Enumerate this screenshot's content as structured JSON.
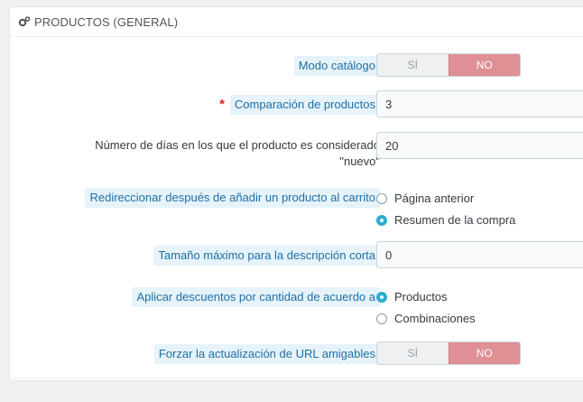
{
  "panel": {
    "title": "PRODUCTOS (GENERAL)",
    "icon": "gears-icon"
  },
  "fields": {
    "catalog_mode": {
      "label": "Modo catálogo",
      "yes": "SÍ",
      "no": "NO"
    },
    "comparison": {
      "required_mark": "*",
      "label": "Comparación de productos",
      "value": "3"
    },
    "new_days": {
      "label_line1": "Número de días en los que el producto es considerado",
      "label_line2": "\"nuevo\"",
      "value": "20"
    },
    "redirect": {
      "label": "Redireccionar después de añadir un producto al carrito",
      "option1": "Página anterior",
      "option2": "Resumen de la compra",
      "selected": "Resumen de la compra"
    },
    "short_desc": {
      "label": "Tamaño máximo para la descripción corta",
      "value": "0"
    },
    "discounts": {
      "label": "Aplicar descuentos por cantidad de acuerdo a",
      "option1": "Productos",
      "option2": "Combinaciones",
      "selected": "Productos"
    },
    "friendly_url": {
      "label": "Forzar la actualización de URL amigables",
      "yes": "SÍ",
      "no": "NO"
    }
  },
  "colors": {
    "accent": "#2eacce",
    "no_active": "#e08f95",
    "hint_bg": "#e6f3fb",
    "hint_text": "#1f6fa6"
  }
}
